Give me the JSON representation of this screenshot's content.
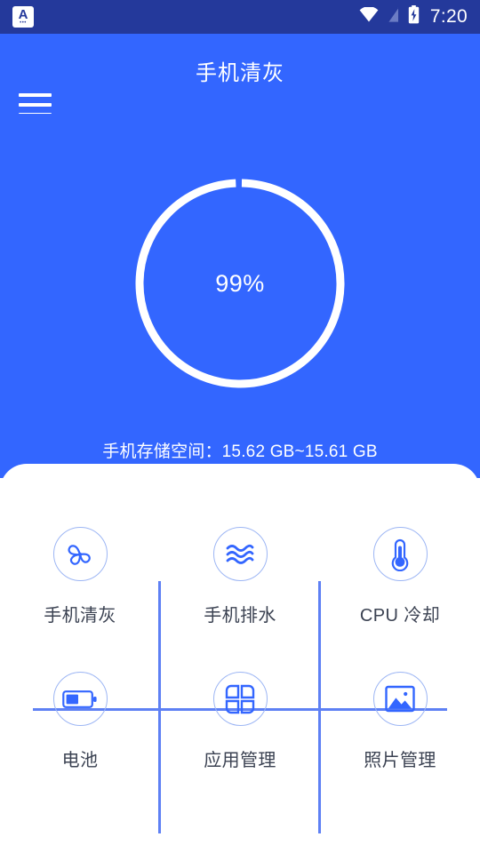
{
  "status_bar": {
    "app_icon": "app-badge-icon",
    "app_icon_letter": "A",
    "app_icon_dots": "•••",
    "icons": [
      "wifi-icon",
      "signal-off-icon",
      "battery-charging-icon"
    ],
    "clock": "7:20",
    "background": "#24399b"
  },
  "app_bar": {
    "menu_icon": "hamburger-menu-icon",
    "title": "手机清灰",
    "background": "#3366ff"
  },
  "hero": {
    "progress": {
      "percent_label": "99%",
      "value": 99,
      "max": 100,
      "ring_color": "#ffffff",
      "track_color": "#3366ff"
    },
    "storage_text": "手机存储空间：15.62 GB~15.61 GB"
  },
  "card": {
    "accent_color": "#3366ff",
    "divider_color": "#5e80f4",
    "icon_ring_color": "#9db6f4",
    "label_color": "#3b4252",
    "tools": [
      {
        "icon": "fan-icon",
        "label": "手机清灰"
      },
      {
        "icon": "water-waves-icon",
        "label": "手机排水"
      },
      {
        "icon": "thermometer-icon",
        "label": "CPU 冷却"
      },
      {
        "icon": "battery-icon",
        "label": "电池"
      },
      {
        "icon": "app-grid-icon",
        "label": "应用管理"
      },
      {
        "icon": "photo-icon",
        "label": "照片管理"
      }
    ]
  }
}
